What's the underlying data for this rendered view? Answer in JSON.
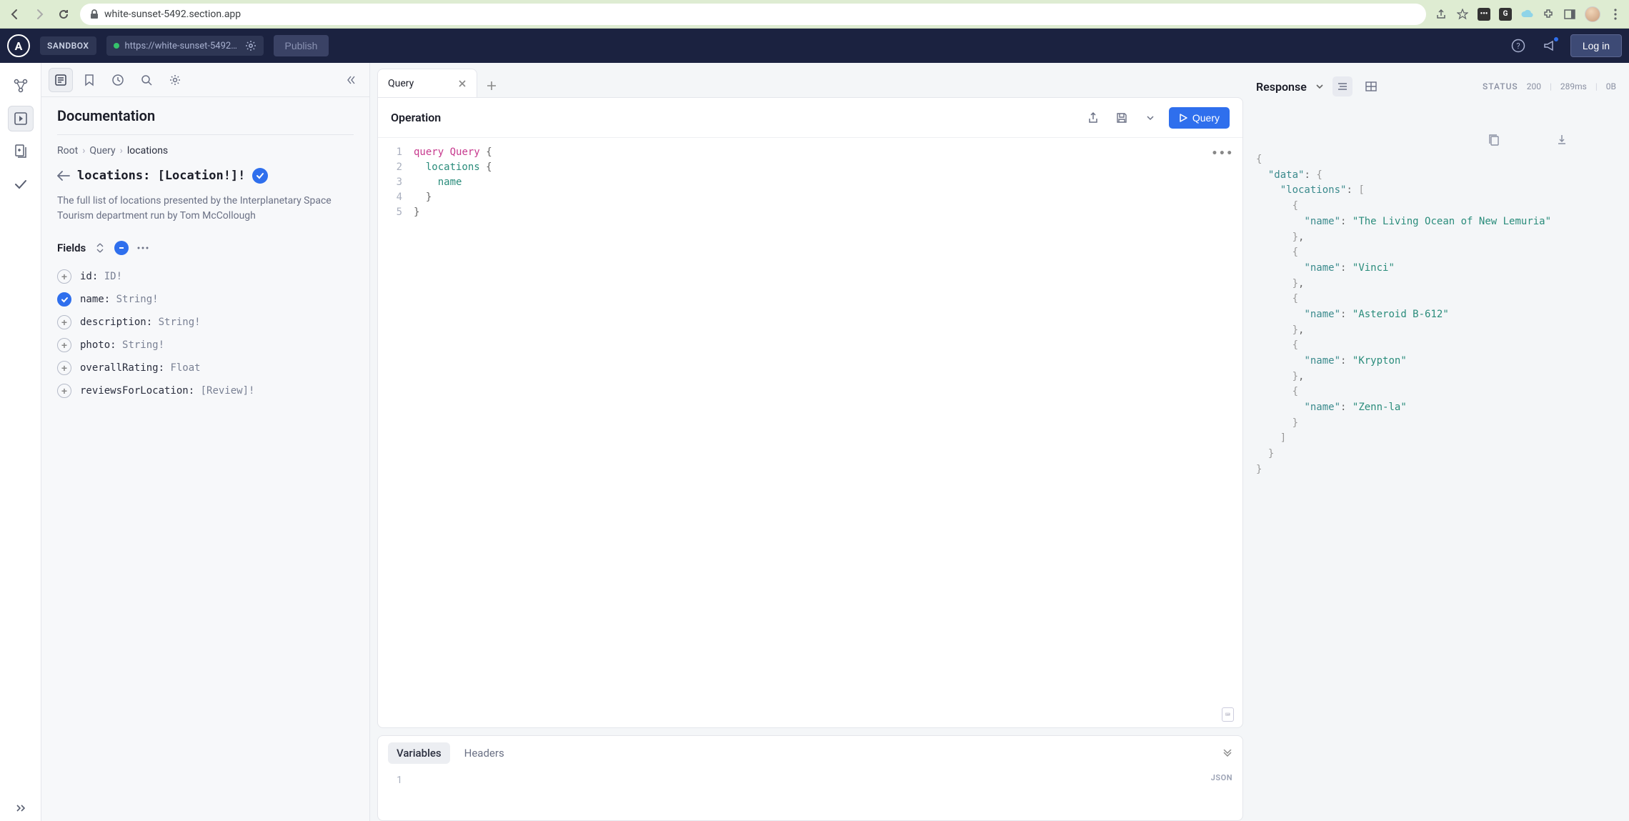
{
  "browser": {
    "url": "white-sunset-5492.section.app"
  },
  "topbar": {
    "badge": "SANDBOX",
    "sandbox_url": "https://white-sunset-5492.sec",
    "publish": "Publish",
    "login": "Log in"
  },
  "doc": {
    "title": "Documentation",
    "crumb_root": "Root",
    "crumb_query": "Query",
    "crumb_current": "locations",
    "type_sig": "locations: [Location!]!",
    "description": "The full list of locations presented by the Interplanetary Space Tourism department run by Tom McCollough",
    "fields_label": "Fields",
    "fields": [
      {
        "name": "id",
        "type": "ID!",
        "selected": false
      },
      {
        "name": "name",
        "type": "String!",
        "selected": true
      },
      {
        "name": "description",
        "type": "String!",
        "selected": false
      },
      {
        "name": "photo",
        "type": "String!",
        "selected": false
      },
      {
        "name": "overallRating",
        "type": "Float",
        "selected": false
      },
      {
        "name": "reviewsForLocation",
        "type": "[Review]!",
        "selected": false
      }
    ]
  },
  "operation": {
    "tab_label": "Query",
    "header": "Operation",
    "run_label": "Query",
    "code": {
      "kw": "query",
      "name": "Query",
      "field_root": "locations",
      "field_leaf": "name"
    },
    "vars_tab": "Variables",
    "headers_tab": "Headers",
    "vars_badge": "JSON",
    "line_numbers": [
      "1",
      "2",
      "3",
      "4",
      "5"
    ]
  },
  "response": {
    "title": "Response",
    "status_label": "STATUS",
    "status_code": "200",
    "timing": "289ms",
    "size": "0B",
    "data": {
      "locations": [
        {
          "name": "The Living Ocean of New Lemuria"
        },
        {
          "name": "Vinci"
        },
        {
          "name": "Asteroid B-612"
        },
        {
          "name": "Krypton"
        },
        {
          "name": "Zenn-la"
        }
      ]
    }
  }
}
